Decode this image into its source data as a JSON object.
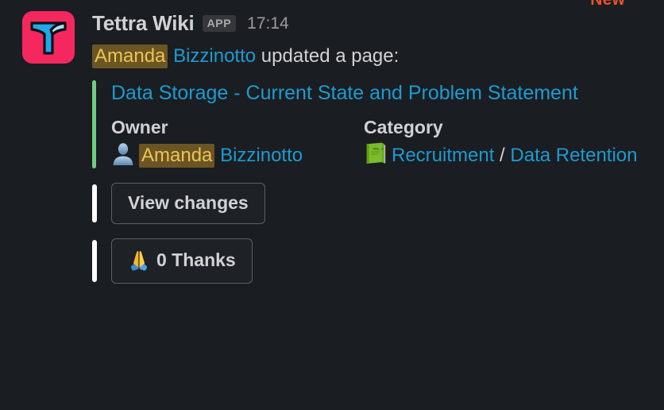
{
  "theme": {
    "background": "#1a1d21",
    "text_primary": "#d1d2d3",
    "text_muted": "#9a9b9e",
    "link": "#1d9bd1",
    "attachment_bar": "#6ece7f",
    "action_bar": "#ffffff",
    "mention_bg": "#6b5524",
    "mention_fg": "#edc553",
    "brand_logo_bg": "#f5275f",
    "new_divider": "#e8532a",
    "badge_bg": "#35373b",
    "button_border": "#5c6066"
  },
  "divider": {
    "new_label": "New"
  },
  "message": {
    "avatar_icon": "tettra-logo-icon",
    "sender": "Tettra Wiki",
    "app_badge": "APP",
    "timestamp": "17:14",
    "text": {
      "mention": "Amanda",
      "mention_surname": "Bizzinotto",
      "action": "updated a page:"
    }
  },
  "attachment": {
    "title": "Data Storage - Current State and Problem Statement",
    "fields": [
      {
        "label": "Owner",
        "icon": "bust-in-silhouette-icon",
        "mention": "Amanda",
        "surname": "Bizzinotto"
      },
      {
        "label": "Category",
        "icon": "green-book-icon",
        "primary": "Recruitment",
        "separator": "/",
        "secondary": "Data Retention"
      }
    ]
  },
  "actions": [
    {
      "id": "view-changes",
      "label": "View changes",
      "icon": null
    },
    {
      "id": "thanks",
      "label": "0 Thanks",
      "icon": "folded-hands-icon"
    }
  ]
}
